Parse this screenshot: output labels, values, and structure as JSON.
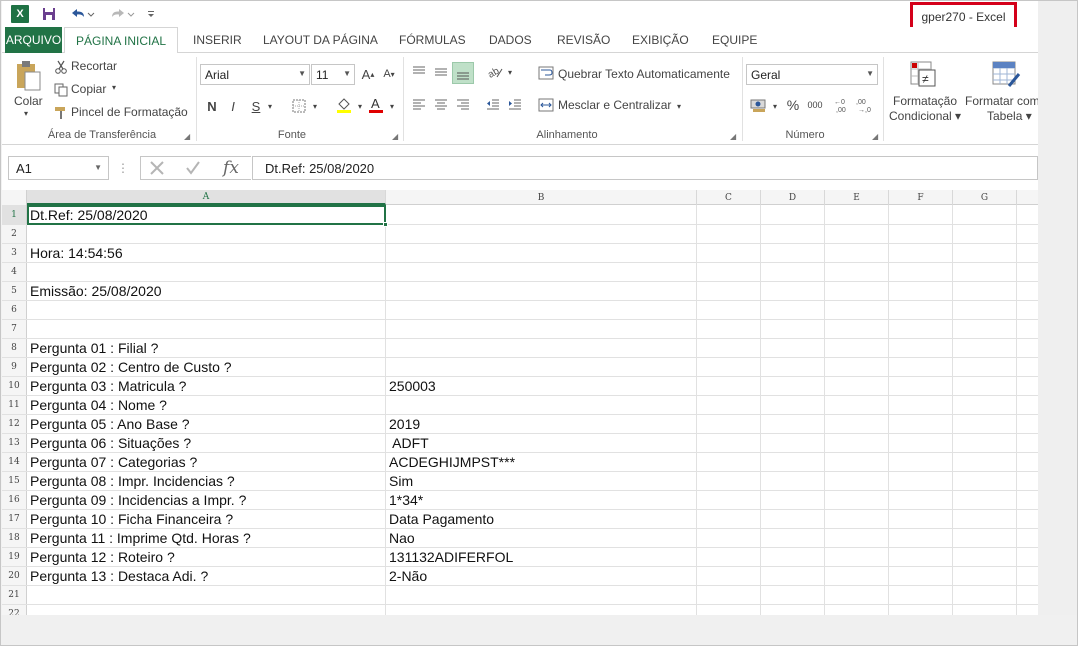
{
  "window": {
    "title": "gper270 - Excel",
    "app_icon": "X"
  },
  "quick_access": {
    "save_icon": "save-icon",
    "undo_icon": "undo-icon",
    "redo_icon": "redo-icon",
    "customize_icon": "customize-icon"
  },
  "tabs": [
    {
      "label": "ARQUIVO"
    },
    {
      "label": "PÁGINA INICIAL"
    },
    {
      "label": "INSERIR"
    },
    {
      "label": "LAYOUT DA PÁGINA"
    },
    {
      "label": "FÓRMULAS"
    },
    {
      "label": "DADOS"
    },
    {
      "label": "REVISÃO"
    },
    {
      "label": "EXIBIÇÃO"
    },
    {
      "label": "EQUIPE"
    }
  ],
  "ribbon": {
    "clipboard": {
      "paste": "Colar",
      "cut": "Recortar",
      "copy": "Copiar",
      "painter": "Pincel de Formatação",
      "group": "Área de Transferência"
    },
    "font": {
      "name": "Arial",
      "size": "11",
      "bold": "N",
      "italic": "I",
      "underline": "S",
      "group": "Fonte"
    },
    "alignment": {
      "wrap": "Quebrar Texto Automaticamente",
      "merge": "Mesclar e Centralizar",
      "group": "Alinhamento"
    },
    "number": {
      "format": "Geral",
      "percent": "%",
      "thousands": "000",
      "group": "Número"
    },
    "styles": {
      "conditional_line1": "Formatação",
      "conditional_line2": "Condicional",
      "table_line1": "Formatar como",
      "table_line2": "Tabela"
    }
  },
  "formula_bar": {
    "name_box": "A1",
    "fx": "fx",
    "value": "Dt.Ref: 25/08/2020"
  },
  "sheet": {
    "columns": [
      "A",
      "B",
      "C",
      "D",
      "E",
      "F",
      "G"
    ],
    "rows": [
      {
        "n": "1",
        "a": "Dt.Ref: 25/08/2020",
        "b": ""
      },
      {
        "n": "2",
        "a": "",
        "b": ""
      },
      {
        "n": "3",
        "a": "Hora: 14:54:56",
        "b": ""
      },
      {
        "n": "4",
        "a": "",
        "b": ""
      },
      {
        "n": "5",
        "a": "Emissão: 25/08/2020",
        "b": ""
      },
      {
        "n": "6",
        "a": "",
        "b": ""
      },
      {
        "n": "7",
        "a": "",
        "b": ""
      },
      {
        "n": "8",
        "a": "Pergunta 01 : Filial ?",
        "b": ""
      },
      {
        "n": "9",
        "a": "Pergunta 02 : Centro de Custo ?",
        "b": ""
      },
      {
        "n": "10",
        "a": "Pergunta 03 : Matricula ?",
        "b": "250003"
      },
      {
        "n": "11",
        "a": "Pergunta 04 : Nome ?",
        "b": ""
      },
      {
        "n": "12",
        "a": "Pergunta 05 : Ano Base ?",
        "b": "2019"
      },
      {
        "n": "13",
        "a": "Pergunta 06 : Situações ?",
        "b": " ADFT"
      },
      {
        "n": "14",
        "a": "Pergunta 07 : Categorias ?",
        "b": "ACDEGHIJMPST***"
      },
      {
        "n": "15",
        "a": "Pergunta 08 : Impr. Incidencias ?",
        "b": "Sim"
      },
      {
        "n": "16",
        "a": "Pergunta 09 : Incidencias a Impr. ?",
        "b": "1*34*"
      },
      {
        "n": "17",
        "a": "Pergunta 10 : Ficha Financeira ?",
        "b": "Data Pagamento"
      },
      {
        "n": "18",
        "a": "Pergunta 11 : Imprime Qtd. Horas ?",
        "b": "Nao"
      },
      {
        "n": "19",
        "a": "Pergunta 12 : Roteiro ?",
        "b": "131132ADIFERFOL"
      },
      {
        "n": "20",
        "a": "Pergunta 13 : Destaca Adi. ?",
        "b": "2-Não"
      },
      {
        "n": "21",
        "a": "",
        "b": ""
      },
      {
        "n": "22",
        "a": "",
        "b": ""
      }
    ]
  }
}
